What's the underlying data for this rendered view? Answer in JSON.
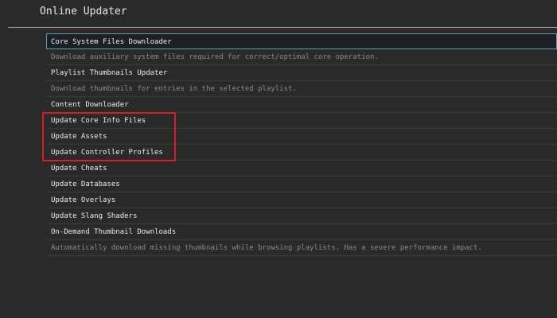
{
  "header": {
    "title": "Online Updater"
  },
  "menu": [
    {
      "label": "Core System Files Downloader",
      "type": "item",
      "selected": true
    },
    {
      "label": "Download auxiliary system files required for correct/optimal core operation.",
      "type": "desc"
    },
    {
      "label": "Playlist Thumbnails Updater",
      "type": "item"
    },
    {
      "label": "Download thumbnails for entries in the selected playlist.",
      "type": "desc"
    },
    {
      "label": "Content Downloader",
      "type": "item"
    },
    {
      "label": "Update Core Info Files",
      "type": "item"
    },
    {
      "label": "Update Assets",
      "type": "item"
    },
    {
      "label": "Update Controller Profiles",
      "type": "item"
    },
    {
      "label": "Update Cheats",
      "type": "item"
    },
    {
      "label": "Update Databases",
      "type": "item"
    },
    {
      "label": "Update Overlays",
      "type": "item"
    },
    {
      "label": "Update Slang Shaders",
      "type": "item"
    },
    {
      "label": "On-Demand Thumbnail Downloads",
      "type": "item"
    },
    {
      "label": "Automatically download missing thumbnails while browsing playlists. Has a severe performance impact.",
      "type": "desc"
    }
  ],
  "colors": {
    "background": "#2a2a2a",
    "selection_border": "#5aa3ad",
    "annotation": "#d4202a"
  }
}
